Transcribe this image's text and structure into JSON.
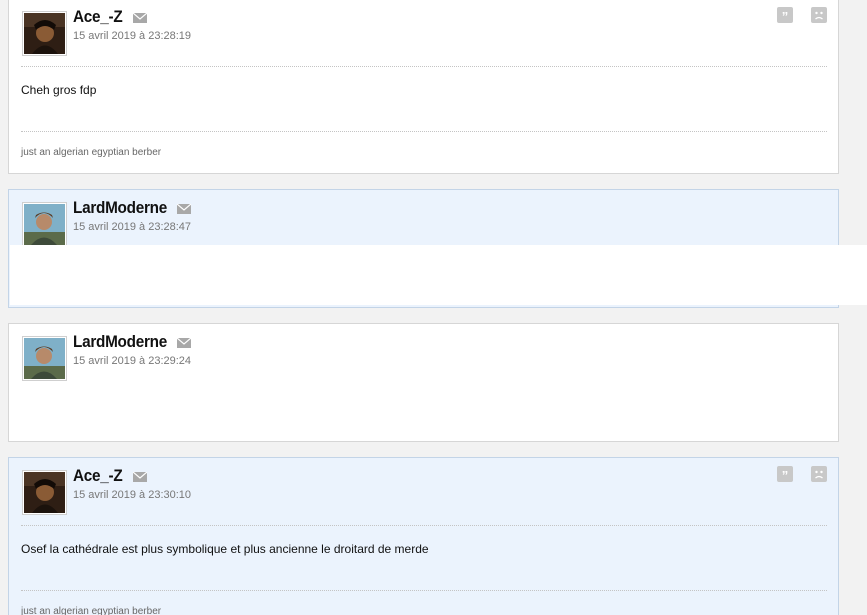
{
  "colors": {
    "post_bg": "#ffffff",
    "post_alt_bg": "#ebf3fd",
    "border": "#d6d6d6",
    "icon_grey": "#b5b5b5"
  },
  "posts": [
    {
      "author": "Ace_-Z",
      "date": "15 avril 2019 à 23:28:19",
      "message": "Cheh gros fdp",
      "signature": "just an algerian egyptian berber",
      "icons": [
        "mail-icon",
        "quote-icon",
        "report-icon"
      ]
    },
    {
      "author": "LardModerne",
      "date": "15 avril 2019 à 23:28:47",
      "icons": [
        "mail-icon"
      ]
    },
    {
      "author": "LardModerne",
      "date": "15 avril 2019 à 23:29:24",
      "icons": [
        "mail-icon"
      ]
    },
    {
      "author": "Ace_-Z",
      "date": "15 avril 2019 à 23:30:10",
      "message": "Osef la cathédrale est plus symbolique et plus ancienne le droitard de merde",
      "signature": "just an algerian egyptian berber",
      "icons": [
        "mail-icon",
        "quote-icon",
        "report-icon"
      ]
    }
  ]
}
